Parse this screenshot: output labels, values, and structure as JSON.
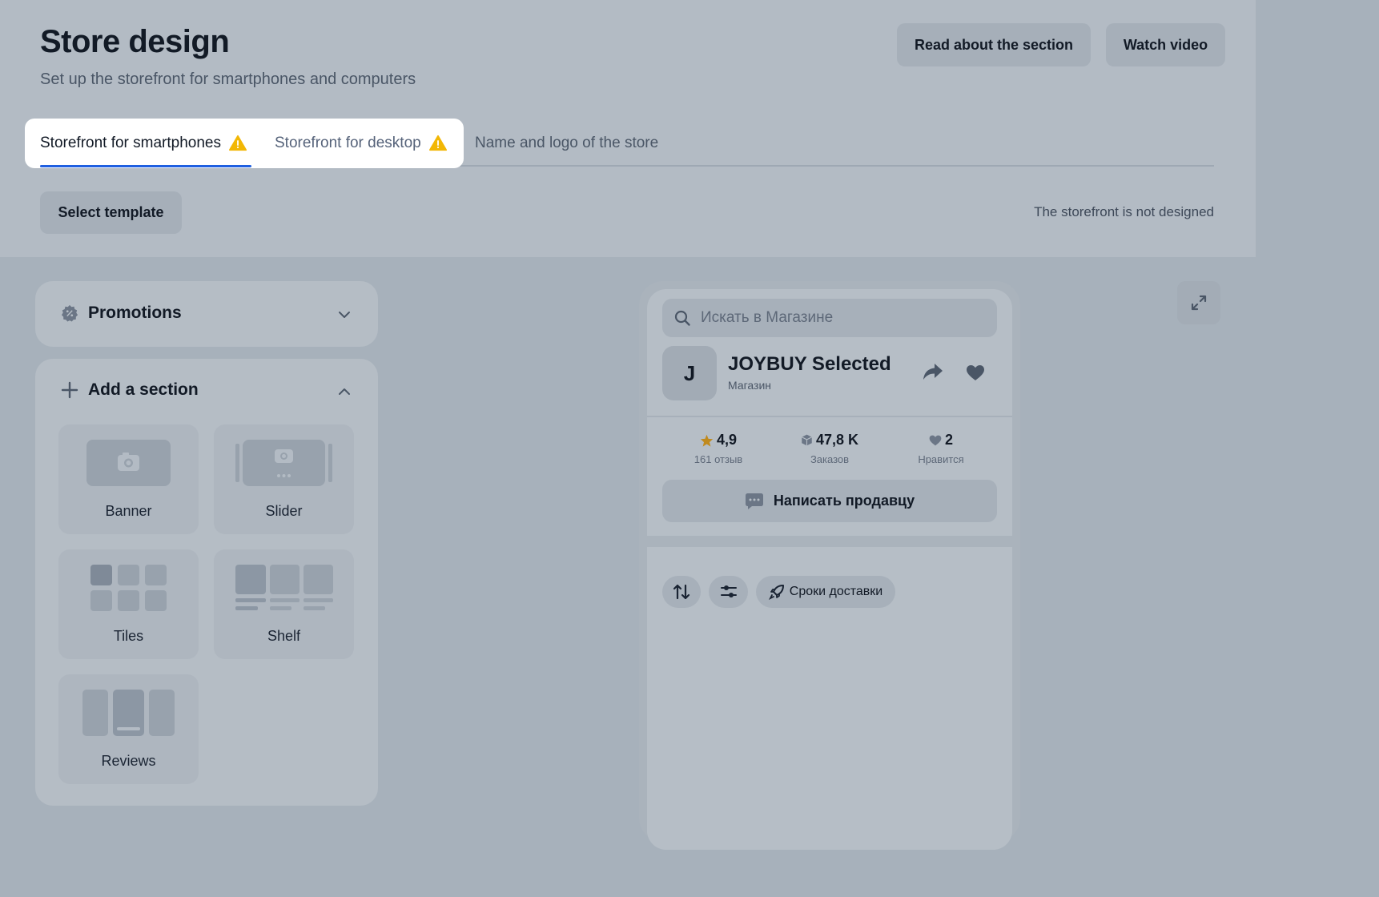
{
  "header": {
    "title": "Store design",
    "subtitle": "Set up the storefront for smartphones and computers",
    "read_label": "Read about the section",
    "watch_label": "Watch video"
  },
  "tabs": [
    {
      "label": "Storefront for smartphones",
      "active": true,
      "warning": true
    },
    {
      "label": "Storefront for desktop",
      "active": false,
      "warning": true
    },
    {
      "label": "Name and logo of the store",
      "active": false,
      "warning": false
    }
  ],
  "toolbar": {
    "select_template_label": "Select template",
    "status": "The storefront is not designed"
  },
  "promotions": {
    "label": "Promotions"
  },
  "add_section": {
    "label": "Add a section",
    "items": [
      {
        "label": "Banner",
        "icon": "banner-icon"
      },
      {
        "label": "Slider",
        "icon": "slider-icon"
      },
      {
        "label": "Tiles",
        "icon": "tiles-icon"
      },
      {
        "label": "Shelf",
        "icon": "shelf-icon"
      },
      {
        "label": "Reviews",
        "icon": "reviews-icon"
      }
    ]
  },
  "preview": {
    "search_placeholder": "Искать в Магазине",
    "avatar_letter": "J",
    "store_name": "JOYBUY Selected",
    "store_type": "Магазин",
    "stats": [
      {
        "value": "4,9",
        "label": "161 отзыв",
        "icon": "star-icon"
      },
      {
        "value": "47,8 K",
        "label": "Заказов",
        "icon": "box-icon"
      },
      {
        "value": "2",
        "label": "Нравится",
        "icon": "heart-icon"
      }
    ],
    "write_seller_label": "Написать продавцу",
    "delivery_chip_label": "Сроки доставки"
  },
  "colors": {
    "accent": "#1f5fe0",
    "warning": "#f2b705",
    "star": "#c08a1e"
  }
}
